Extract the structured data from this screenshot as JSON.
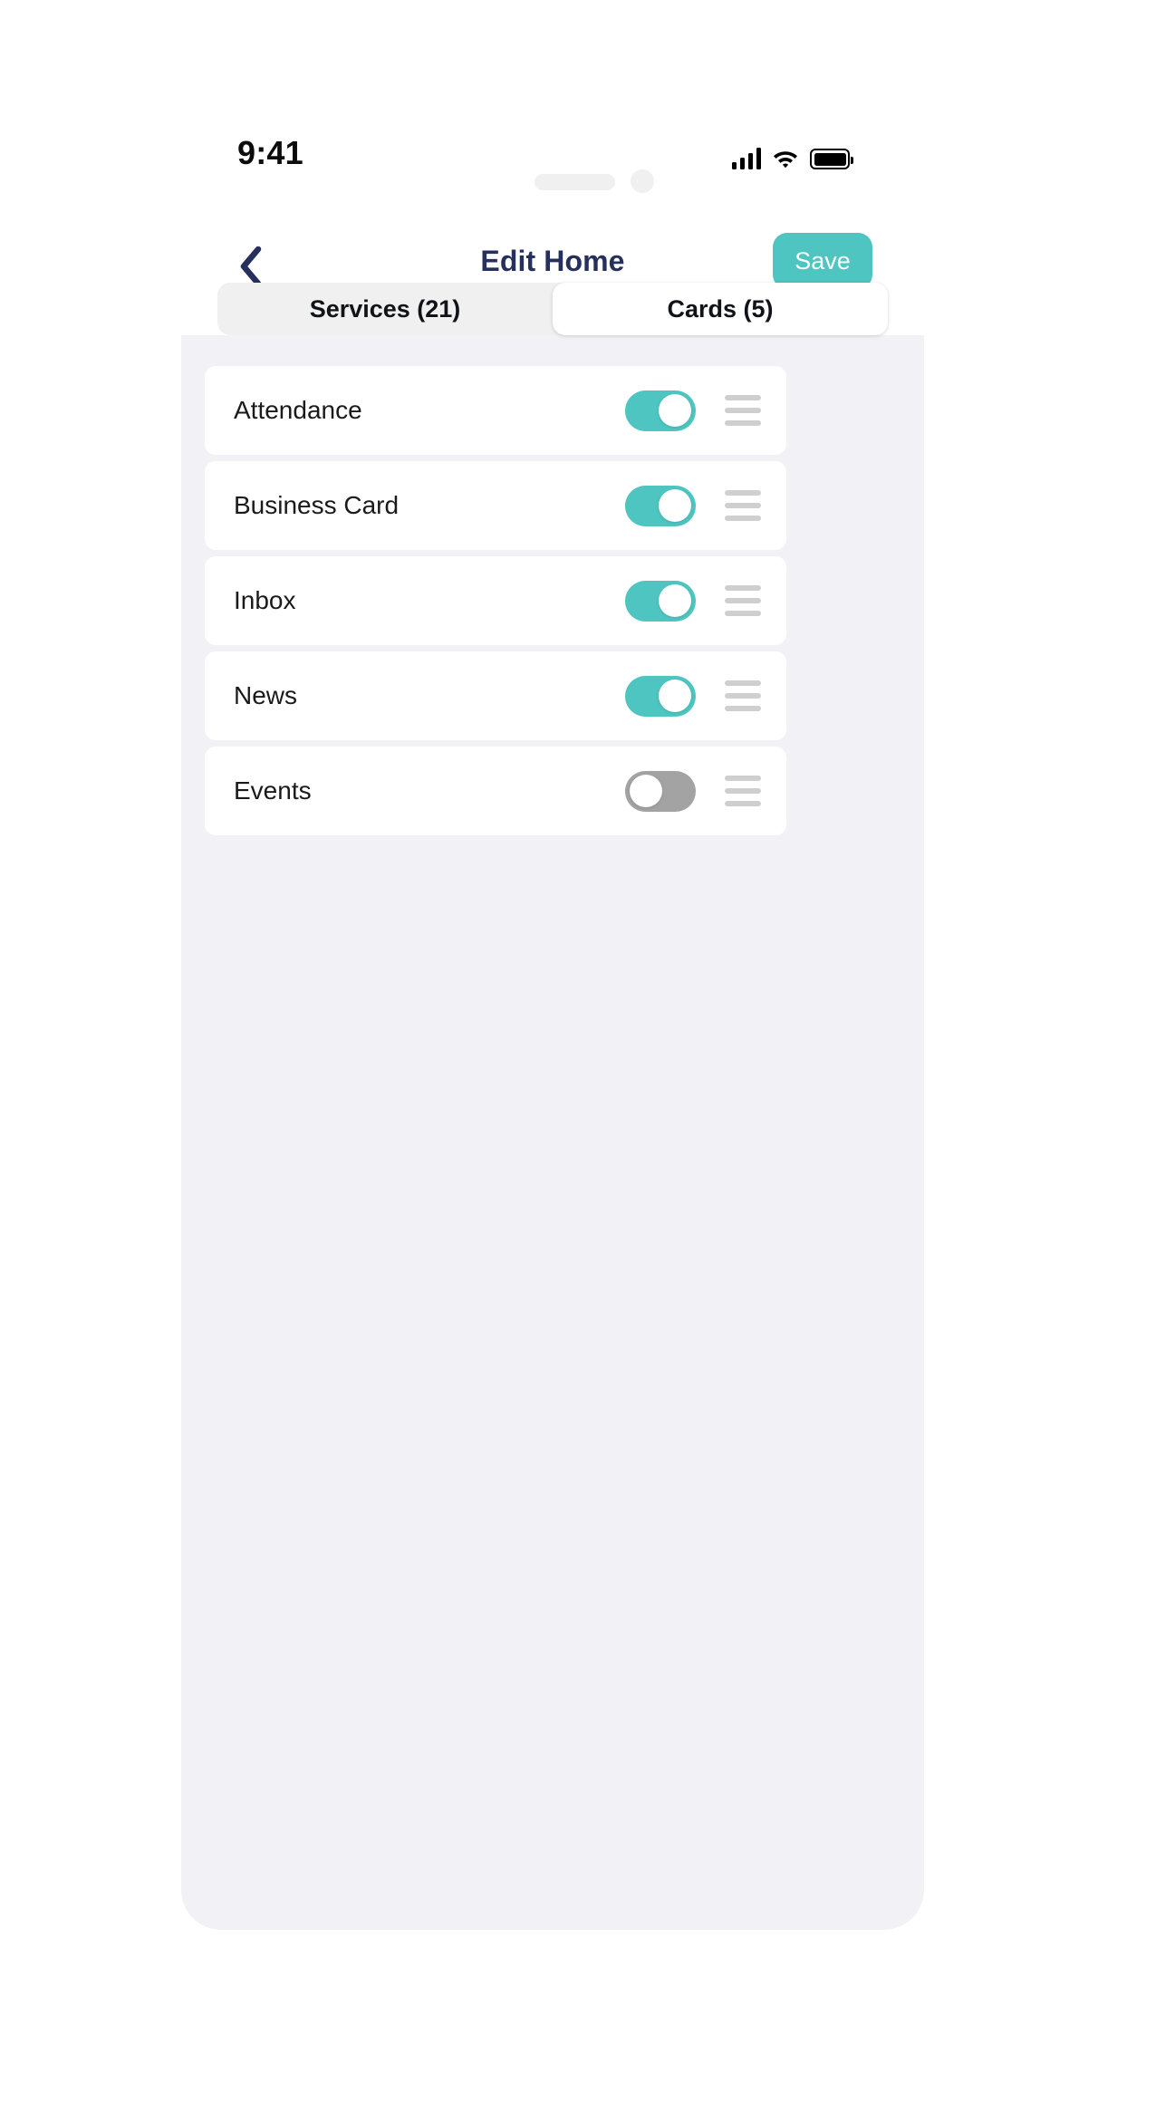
{
  "status_bar": {
    "time": "9:41",
    "cellular_icon": "signal-bars-icon",
    "wifi_icon": "wifi-icon",
    "battery_icon": "battery-full-icon"
  },
  "nav": {
    "back_icon": "chevron-left-icon",
    "title": "Edit Home",
    "save_label": "Save"
  },
  "tabs": [
    {
      "label": "Services (21)",
      "active": false
    },
    {
      "label": "Cards (5)",
      "active": true
    }
  ],
  "cards": [
    {
      "label": "Attendance",
      "enabled": true,
      "handle_icon": "drag-handle-icon"
    },
    {
      "label": "Business Card",
      "enabled": true,
      "handle_icon": "drag-handle-icon"
    },
    {
      "label": "Inbox",
      "enabled": true,
      "handle_icon": "drag-handle-icon"
    },
    {
      "label": "News",
      "enabled": true,
      "handle_icon": "drag-handle-icon"
    },
    {
      "label": "Events",
      "enabled": false,
      "handle_icon": "drag-handle-icon"
    }
  ],
  "colors": {
    "accent": "#4ec5c1",
    "title": "#26305c",
    "toggle_off": "#a3a3a3",
    "content_bg": "#f2f2f6",
    "tab_track": "#f0f0f0",
    "handle": "#cfcfcf"
  }
}
